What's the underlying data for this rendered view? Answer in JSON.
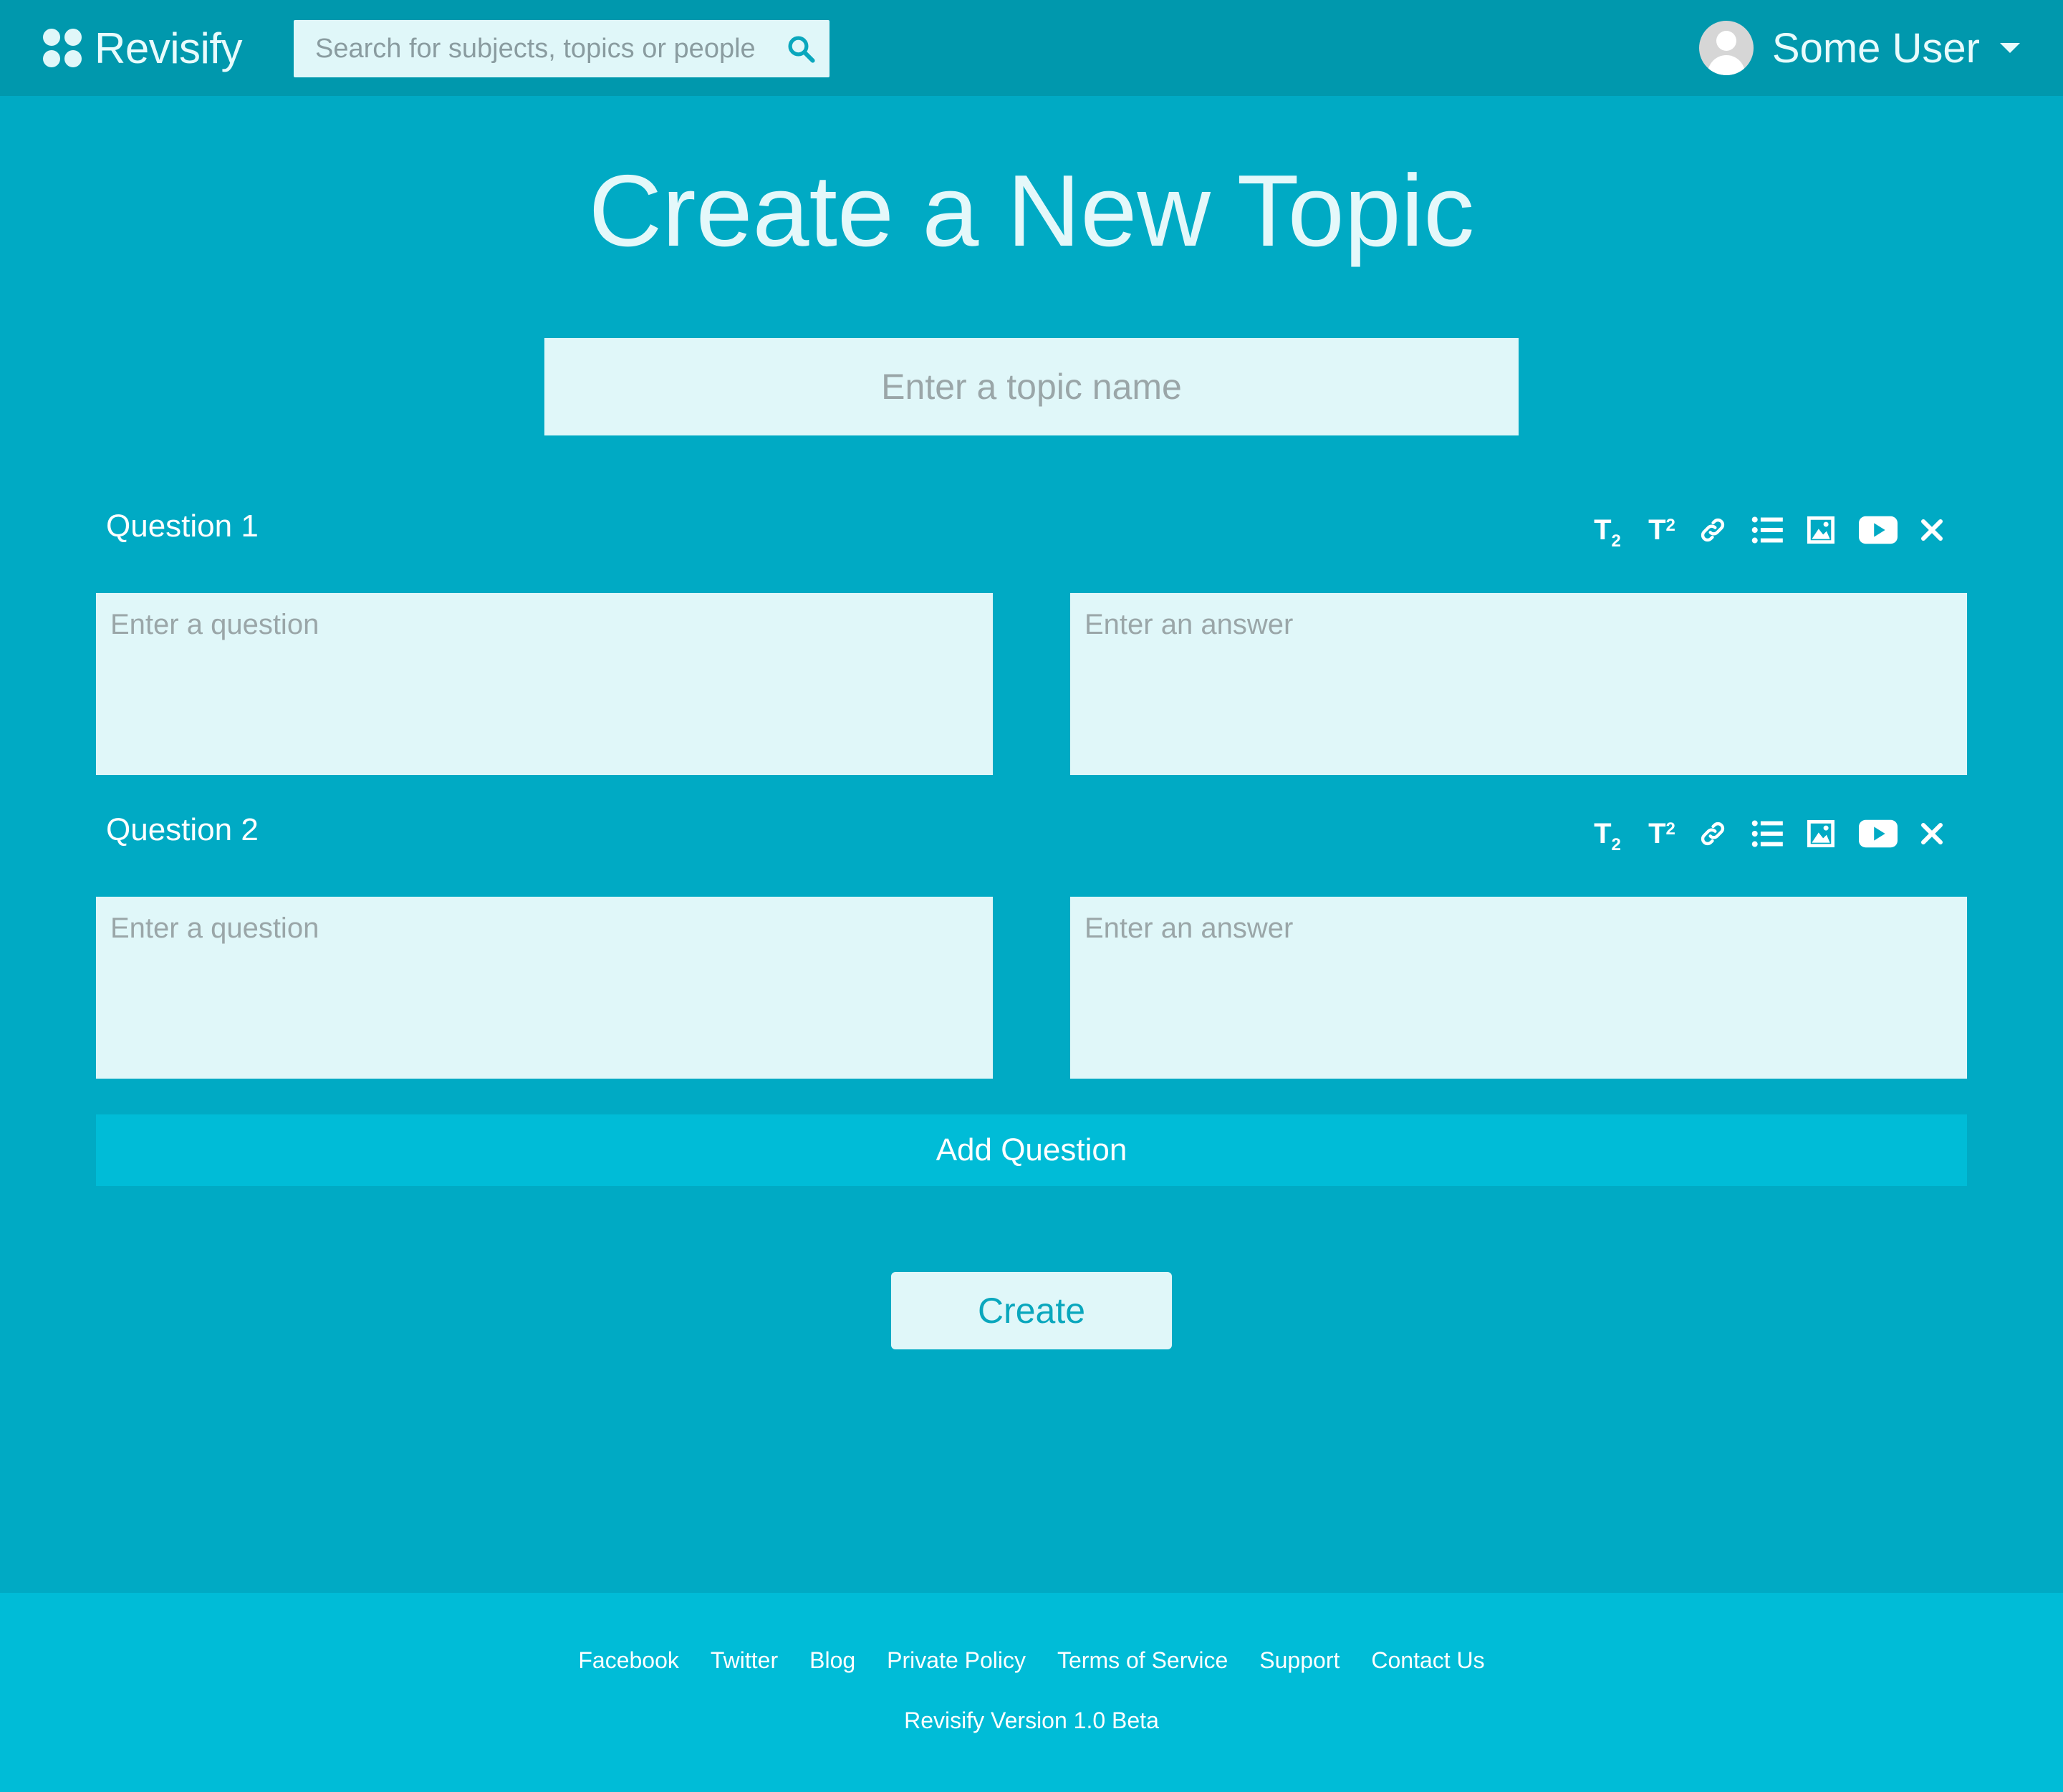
{
  "app": {
    "name": "Revisify"
  },
  "search": {
    "placeholder": "Search for subjects, topics or people"
  },
  "user": {
    "name": "Some User"
  },
  "page": {
    "title": "Create a New Topic"
  },
  "topic": {
    "placeholder": "Enter a topic name"
  },
  "questions": [
    {
      "label": "Question 1",
      "question_placeholder": "Enter a question",
      "answer_placeholder": "Enter an answer"
    },
    {
      "label": "Question 2",
      "question_placeholder": "Enter a question",
      "answer_placeholder": "Enter an answer"
    }
  ],
  "toolbar": {
    "subscript": {
      "glyph": "T",
      "small": "2",
      "icon": "subscript-icon"
    },
    "superscript": {
      "glyph": "T",
      "small": "2",
      "icon": "superscript-icon"
    },
    "icons": [
      "link-icon",
      "list-icon",
      "image-icon",
      "video-icon",
      "close-icon"
    ]
  },
  "actions": {
    "add_question": "Add Question",
    "create": "Create"
  },
  "footer": {
    "links": [
      "Facebook",
      "Twitter",
      "Blog",
      "Private Policy",
      "Terms of Service",
      "Support",
      "Contact Us"
    ],
    "version": "Revisify Version 1.0 Beta"
  },
  "colors": {
    "background": "#00aac4",
    "header": "#0098ad",
    "footer": "#00bcd7",
    "field": "#e0f7f9",
    "accent_text": "#0aa7bd"
  }
}
